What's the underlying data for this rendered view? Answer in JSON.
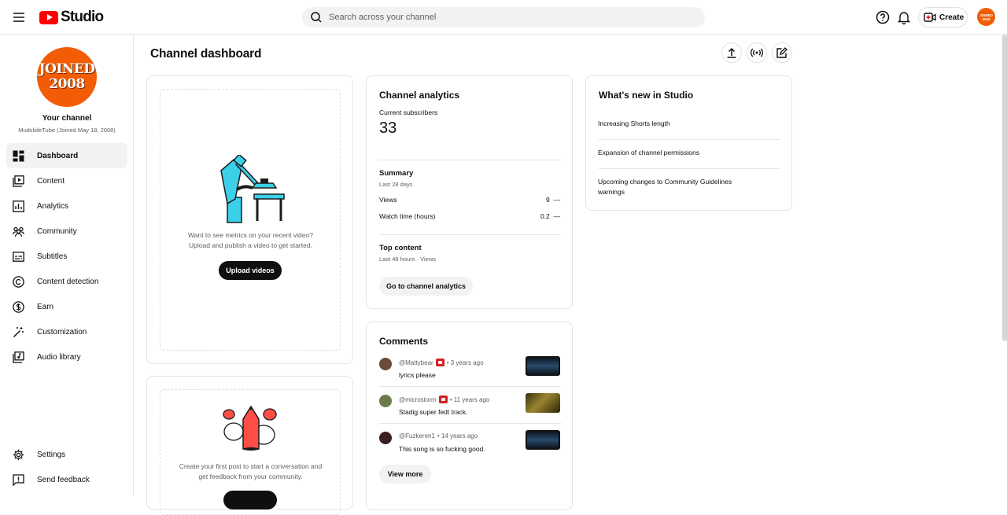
{
  "header": {
    "brand": "Studio",
    "search_placeholder": "Search across your channel",
    "create_label": "Create",
    "avatar_text": "JOINED 2008"
  },
  "sidebar": {
    "avatar_line1": "JOINED",
    "avatar_line2": "2008",
    "your_channel": "Your channel",
    "channel_name": "MudslideTube (Joined May 18, 2008)",
    "items": [
      {
        "label": "Dashboard",
        "icon": "dashboard-icon"
      },
      {
        "label": "Content",
        "icon": "content-icon"
      },
      {
        "label": "Analytics",
        "icon": "analytics-icon"
      },
      {
        "label": "Community",
        "icon": "community-icon"
      },
      {
        "label": "Subtitles",
        "icon": "subtitles-icon"
      },
      {
        "label": "Content detection",
        "icon": "copyright-icon"
      },
      {
        "label": "Earn",
        "icon": "dollar-icon"
      },
      {
        "label": "Customization",
        "icon": "magic-wand-icon"
      },
      {
        "label": "Audio library",
        "icon": "audio-library-icon"
      }
    ],
    "bottom": [
      {
        "label": "Settings",
        "icon": "gear-icon"
      },
      {
        "label": "Send feedback",
        "icon": "feedback-icon"
      }
    ]
  },
  "main": {
    "title": "Channel dashboard",
    "upload_card": {
      "text_line1": "Want to see metrics on your recent video?",
      "text_line2": "Upload and publish a video to get started.",
      "button": "Upload videos"
    },
    "post_card": {
      "text_line1": "Create your first post to start a conversation and",
      "text_line2": "get feedback from your community."
    },
    "analytics": {
      "title": "Channel analytics",
      "subs_label": "Current subscribers",
      "subs_value": "33",
      "summary_title": "Summary",
      "summary_period": "Last 28 days",
      "metrics": [
        {
          "label": "Views",
          "value": "9",
          "trend": "—"
        },
        {
          "label": "Watch time (hours)",
          "value": "0.2",
          "trend": "—"
        }
      ],
      "top_title": "Top content",
      "top_period": "Last 48 hours · Views",
      "button": "Go to channel analytics"
    },
    "comments": {
      "title": "Comments",
      "items": [
        {
          "user": "@Mattybear",
          "time": "• 3 years ago",
          "text": "lyrics please",
          "badge": true,
          "avatar_color": "#6b4a3a",
          "thumb_color": "#1c3550"
        },
        {
          "user": "@microstorm",
          "time": "• 11 years ago",
          "text": "Stadig super fedt track.",
          "badge": true,
          "avatar_color": "#6b7a4a",
          "thumb_color": "#7a6a2a"
        },
        {
          "user": "@Fuzkeren1",
          "time": "• 14 years ago",
          "text": "This song is so fucking good.",
          "badge": false,
          "avatar_color": "#3a2020",
          "thumb_color": "#1c3550"
        }
      ],
      "button": "View more"
    },
    "whats_new": {
      "title": "What's new in Studio",
      "items": [
        "Increasing Shorts length",
        "Expansion of channel permissions",
        "Upcoming changes to Community Guidelines warnings"
      ]
    }
  }
}
